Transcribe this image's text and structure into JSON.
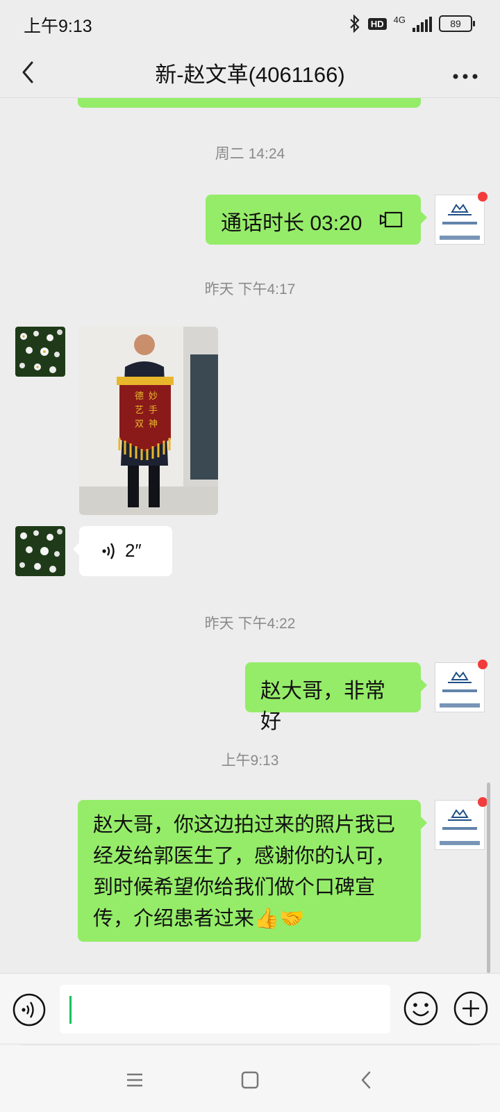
{
  "status_bar": {
    "time": "上午9:13",
    "network": "4G",
    "battery": "89"
  },
  "header": {
    "title": "新-赵文革(4061166)"
  },
  "messages": {
    "ts1": "周二 14:24",
    "call_text": "通话时长 03:20",
    "ts2": "昨天 下午4:17",
    "voice_duration": "2″",
    "ts3": "昨天 下午4:22",
    "msg_short": "赵大哥，非常好",
    "ts4": "上午9:13",
    "msg_long": "赵大哥，你这边拍过来的照片我已经发给郭医生了，感谢你的认可，到时候希望你给我们做个口碑宣传，介绍患者过来👍🤝"
  },
  "banner_text": {
    "line1": "妙手神技",
    "line2": "德艺双佳"
  },
  "avatar_me": {
    "caption": "微视智眼健康中心"
  },
  "colors": {
    "bubble_me": "#95ec69",
    "bubble_other": "#ffffff",
    "accent": "#07c160",
    "unread_dot": "#f23c3c"
  }
}
